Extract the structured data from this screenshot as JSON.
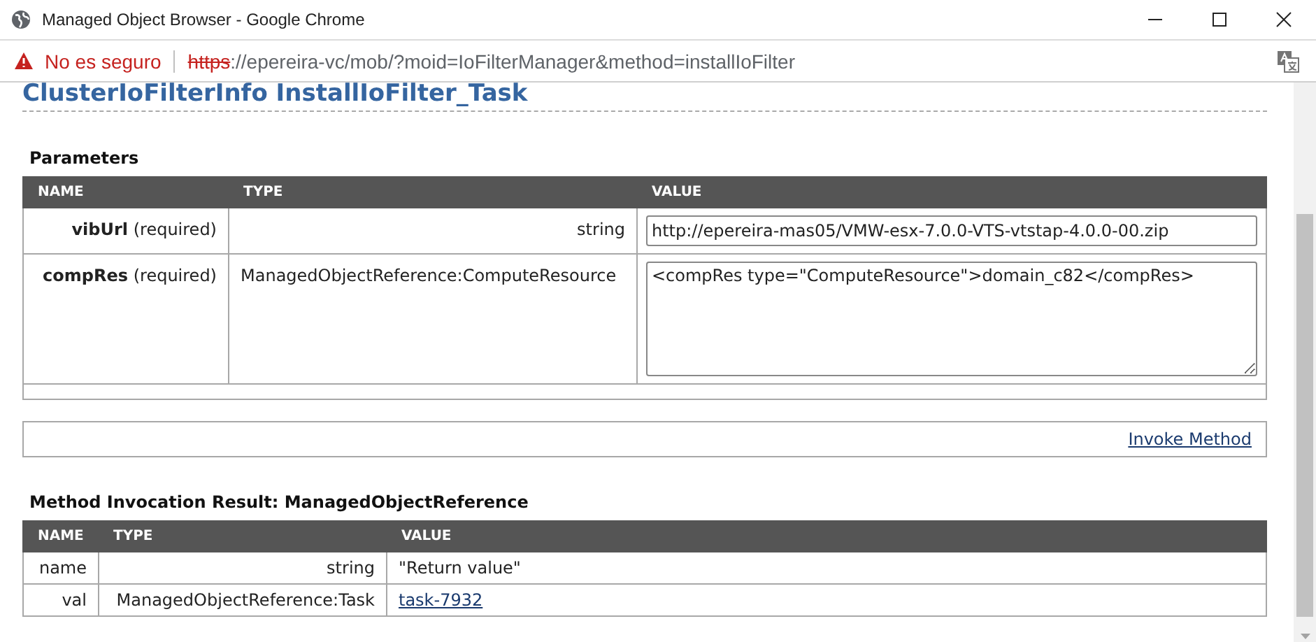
{
  "window": {
    "title": "Managed Object Browser - Google Chrome"
  },
  "address_bar": {
    "security_label": "No es seguro",
    "scheme": "https",
    "url_rest": "://epereira-vc/mob/?moid=IoFilterManager&method=installIoFilter"
  },
  "page": {
    "heading": "ClusterIoFilterInfo InstallIoFilter_Task",
    "parameters": {
      "title": "Parameters",
      "columns": [
        "NAME",
        "TYPE",
        "VALUE"
      ],
      "rows": [
        {
          "name": "**vibUrl** (required)",
          "type": "string",
          "kind": "input",
          "value": "http://epereira-mas05/VMW-esx-7.0.0-VTS-vtstap-4.0.0-00.zip"
        },
        {
          "name": "**compRes** (required)",
          "type": "ManagedObjectReference:ComputeResource",
          "kind": "textarea",
          "value": "<compRes type=\"ComputeResource\">domain_c82</compRes>"
        }
      ]
    },
    "invoke_link": "Invoke Method",
    "result": {
      "title": "Method Invocation Result: ManagedObjectReference",
      "columns": [
        "NAME",
        "TYPE",
        "VALUE"
      ],
      "rows": [
        {
          "name": "name",
          "type": "string",
          "kind": "text",
          "value": "\"Return value\""
        },
        {
          "name": "val",
          "type": "ManagedObjectReference:Task",
          "kind": "link",
          "value": "task-7932"
        }
      ]
    }
  }
}
